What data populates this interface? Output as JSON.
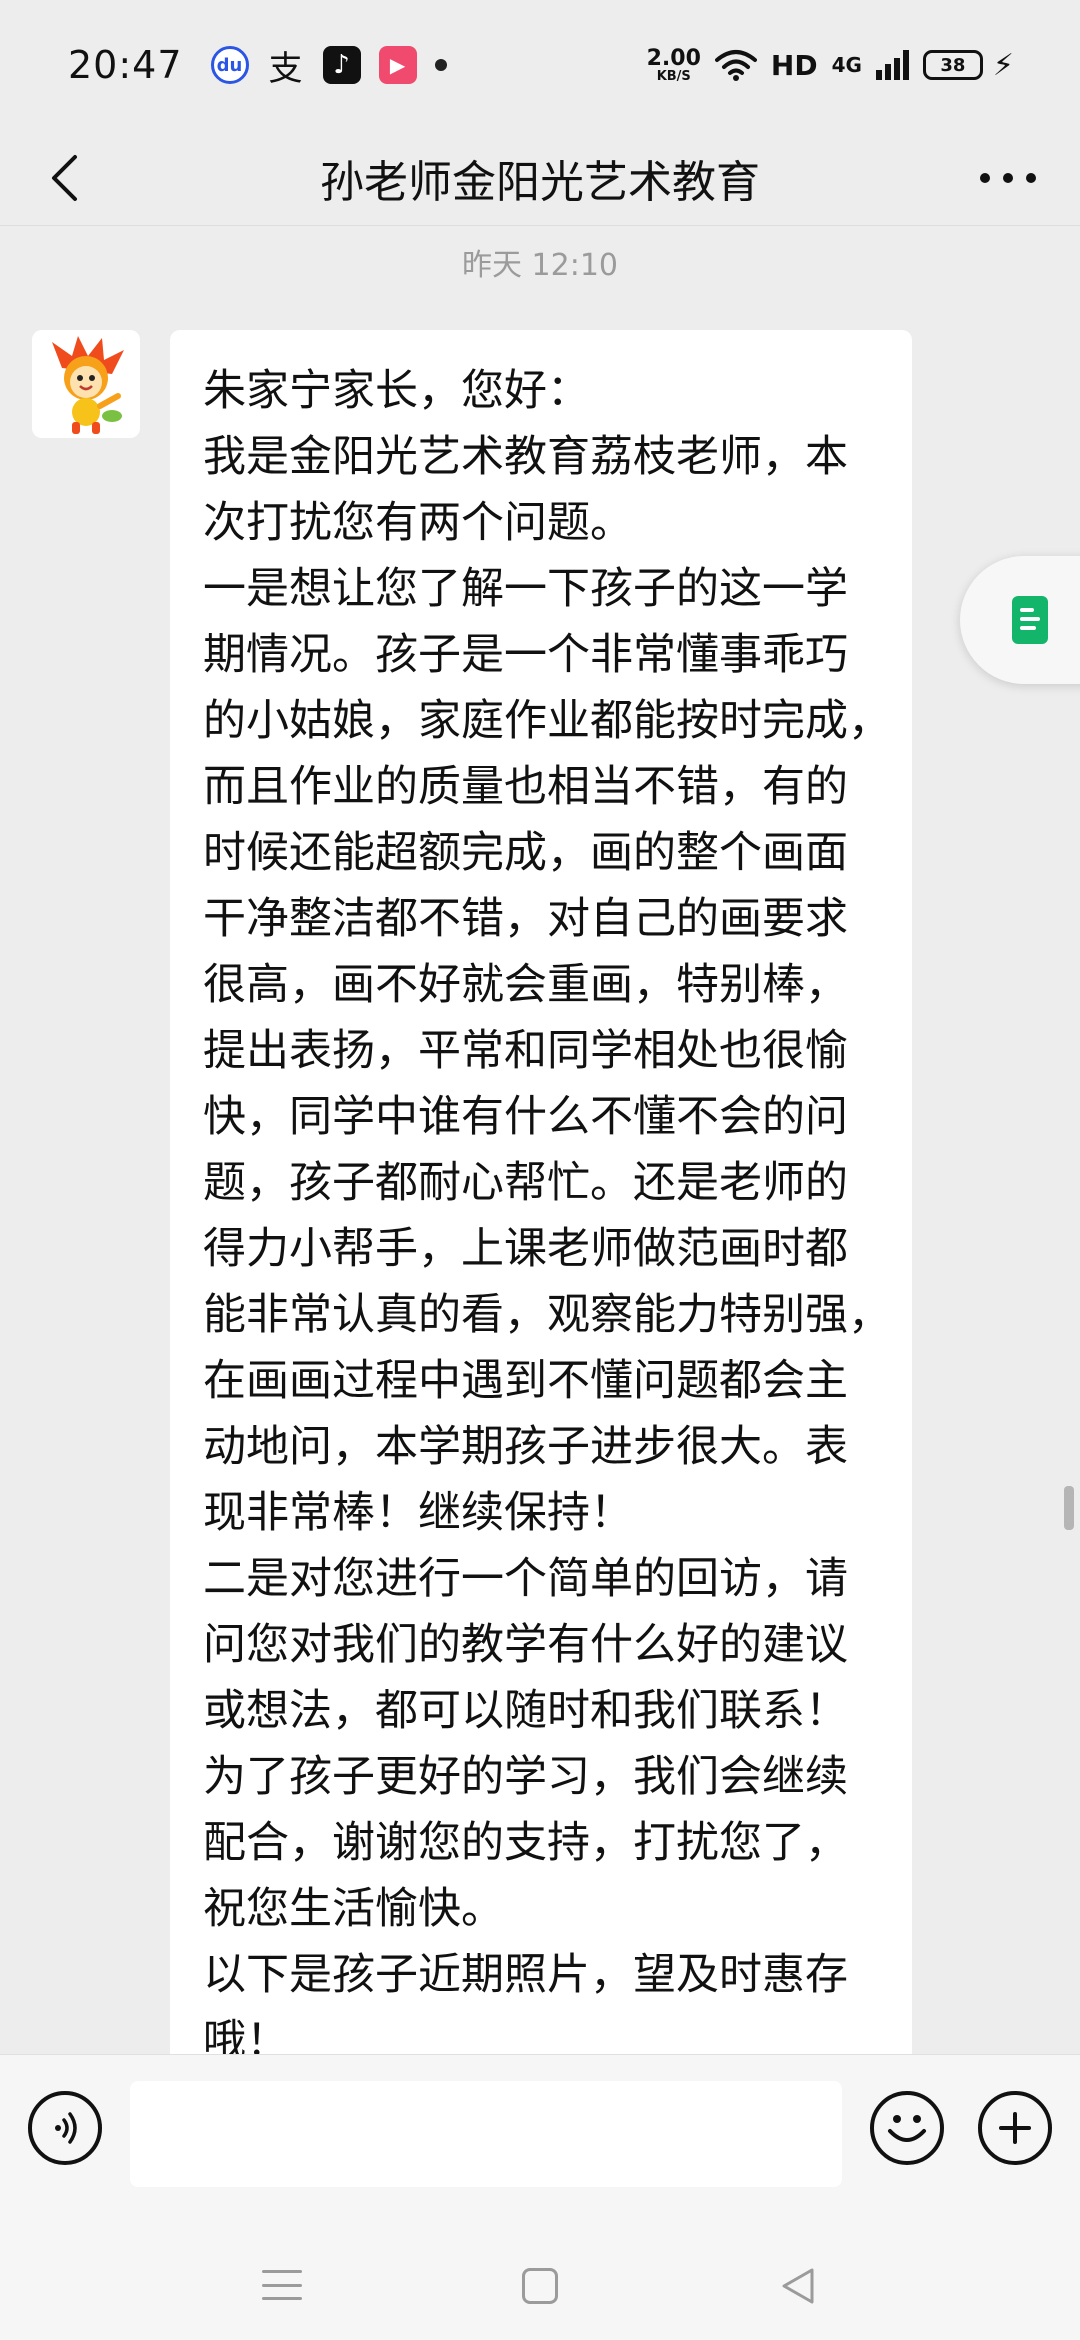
{
  "status_bar": {
    "time": "20:47",
    "net_speed_value": "2.00",
    "net_speed_unit": "KB/S",
    "hd_label": "HD",
    "network_type": "4G",
    "battery_level": "38",
    "apps": [
      "baidu-app-icon",
      "alipay-icon",
      "tiktok-icon",
      "video-app-icon"
    ]
  },
  "header": {
    "title": "孙老师金阳光艺术教育"
  },
  "chat": {
    "timestamp": "昨天 12:10",
    "message_lines": [
      "朱家宁家长，您好：",
      "我是金阳光艺术教育荔枝老师，本",
      "次打扰您有两个问题。",
      "一是想让您了解一下孩子的这一学",
      "期情况。孩子是一个非常懂事乖巧",
      "的小姑娘，家庭作业都能按时完成，",
      "而且作业的质量也相当不错，有的",
      "时候还能超额完成，画的整个画面",
      "干净整洁都不错，对自己的画要求",
      "很高，画不好就会重画，特别棒，",
      "提出表扬，平常和同学相处也很愉",
      "快，同学中谁有什么不懂不会的问",
      "题，孩子都耐心帮忙。还是老师的",
      "得力小帮手，上课老师做范画时都",
      "能非常认真的看，观察能力特别强，",
      "在画画过程中遇到不懂问题都会主",
      "动地问，本学期孩子进步很大。表",
      "现非常棒！继续保持！",
      "二是对您进行一个简单的回访，请",
      "问您对我们的教学有什么好的建议",
      "或想法，都可以随时和我们联系！",
      "为了孩子更好的学习，我们会继续",
      "配合，谢谢您的支持，打扰您了，",
      "祝您生活愉快。",
      "以下是孩子近期照片，望及时惠存",
      "哦！"
    ]
  },
  "input_bar": {
    "value": ""
  },
  "colors": {
    "background": "#ededed",
    "bubble": "#ffffff",
    "accent_green": "#13b56b",
    "timestamp_gray": "#9b9b9b"
  }
}
